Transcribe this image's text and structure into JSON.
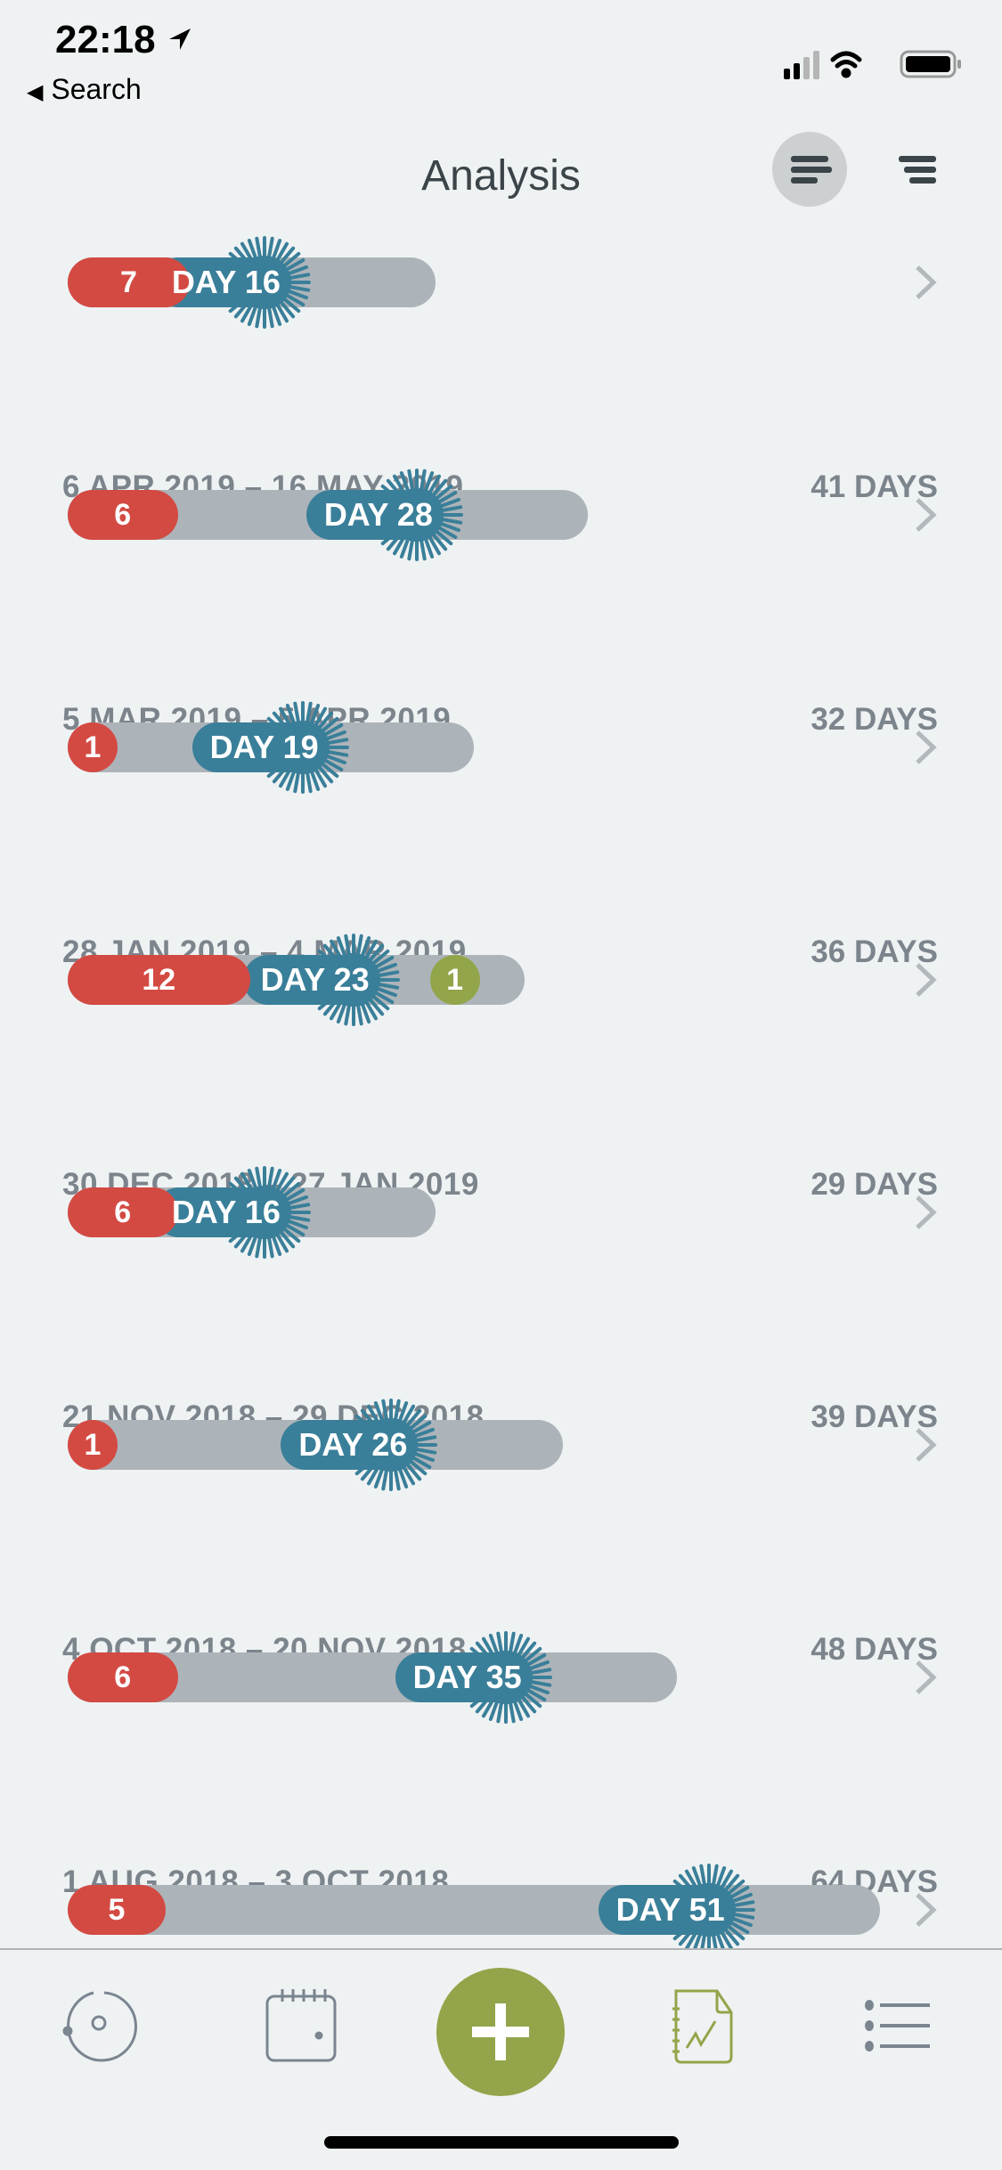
{
  "status_bar": {
    "time": "22:18",
    "back_label": "Search",
    "icons": [
      "location-arrow-icon",
      "signal-icon",
      "wifi-icon",
      "battery-icon"
    ]
  },
  "header": {
    "title": "Analysis",
    "buttons": [
      "sort-lines-icon",
      "filter-lines-icon"
    ]
  },
  "colors": {
    "period": "#d34a43",
    "ovulation": "#3a7f99",
    "bar": "#adb4b9",
    "marker": "#92a54a",
    "accent": "#92a54a"
  },
  "cycles": [
    {
      "range": "",
      "length": "",
      "days": 29,
      "period": 7,
      "day_label": "DAY 16",
      "day": 16,
      "marker": null
    },
    {
      "range": "6 APR 2019 – 16 MAY 2019",
      "length": "41 DAYS",
      "days": 41,
      "period": 6,
      "day_label": "DAY 28",
      "day": 28,
      "marker": null
    },
    {
      "range": "5 MAR 2019 – 5 APR 2019",
      "length": "32 DAYS",
      "days": 32,
      "period": 1,
      "day_label": "DAY 19",
      "day": 19,
      "marker": null
    },
    {
      "range": "28 JAN 2019 – 4 MAR 2019",
      "length": "36 DAYS",
      "days": 36,
      "period": 12,
      "day_label": "DAY 23",
      "day": 23,
      "marker": {
        "label": "1",
        "day": 31
      }
    },
    {
      "range": "30 DEC 2018 – 27 JAN 2019",
      "length": "29 DAYS",
      "days": 29,
      "period": 6,
      "day_label": "DAY 16",
      "day": 16,
      "marker": null
    },
    {
      "range": "21 NOV 2018 – 29 DEC 2018",
      "length": "39 DAYS",
      "days": 39,
      "period": 1,
      "day_label": "DAY 26",
      "day": 26,
      "marker": null
    },
    {
      "range": "4 OCT 2018 – 20 NOV 2018",
      "length": "48 DAYS",
      "days": 48,
      "period": 6,
      "day_label": "DAY 35",
      "day": 35,
      "marker": null
    },
    {
      "range": "1 AUG 2018 – 3 OCT 2018",
      "length": "64 DAYS",
      "days": 64,
      "period": 5,
      "day_label": "DAY 51",
      "day": 51,
      "marker": null
    }
  ],
  "tabbar": {
    "tabs": [
      "cycle-icon",
      "calendar-icon",
      "add-icon",
      "analysis-icon",
      "list-icon"
    ],
    "active": "analysis-icon"
  }
}
